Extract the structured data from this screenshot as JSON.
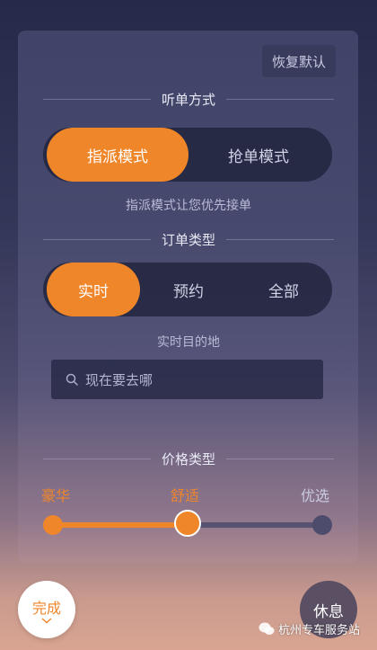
{
  "header": {
    "reset_label": "恢复默认"
  },
  "listen_mode": {
    "title": "听单方式",
    "options": [
      "指派模式",
      "抢单模式"
    ],
    "selected": "指派模式",
    "hint": "指派模式让您优先接单"
  },
  "order_type": {
    "title": "订单类型",
    "options": [
      "实时",
      "预约",
      "全部"
    ],
    "selected": "实时"
  },
  "destination": {
    "title": "实时目的地",
    "placeholder": "现在要去哪"
  },
  "price_type": {
    "title": "价格类型",
    "options": [
      "豪华",
      "舒适",
      "优选"
    ],
    "selected": "舒适",
    "slider_level": 0.5
  },
  "footer": {
    "done_label": "完成",
    "rest_label": "休息",
    "watermark": "杭州专车服务站"
  },
  "colors": {
    "accent": "#f0862a",
    "inactive": "#c9cbe0"
  }
}
